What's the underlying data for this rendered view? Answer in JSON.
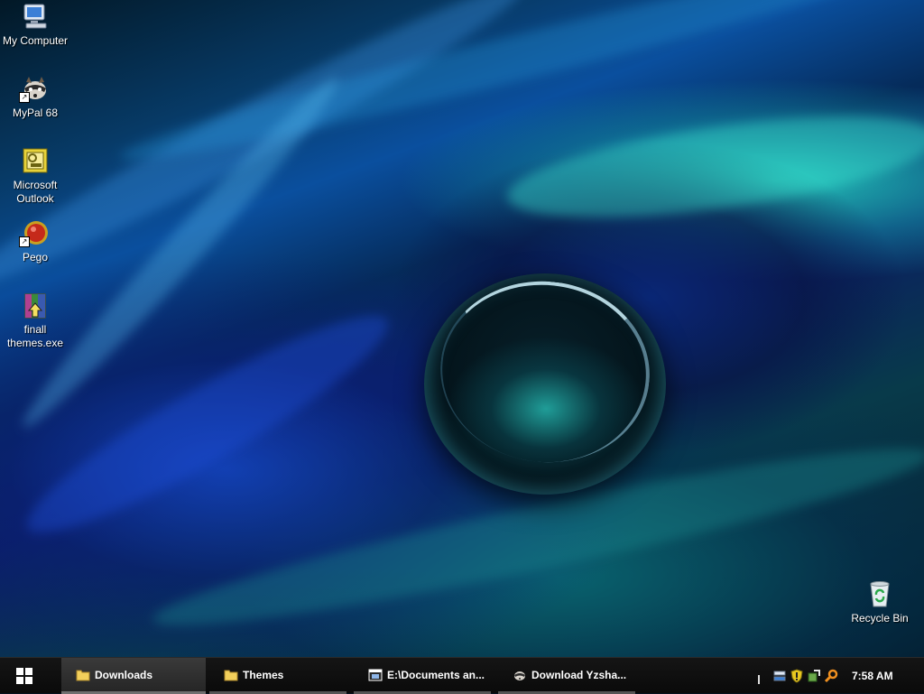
{
  "desktop": {
    "icons": [
      {
        "label": "My Computer",
        "icon": "my-computer-icon"
      },
      {
        "label": "MyPal 68",
        "icon": "mypal-icon"
      },
      {
        "label": "Microsoft Outlook",
        "icon": "outlook-icon"
      },
      {
        "label": "Pego",
        "icon": "pego-icon"
      },
      {
        "label": "finall themes.exe",
        "icon": "winrar-archive-icon"
      },
      {
        "label": "Recycle Bin",
        "icon": "recycle-bin-icon"
      }
    ]
  },
  "taskbar": {
    "start_icon": "windows-logo-icon",
    "tasks": [
      {
        "label": "Downloads",
        "icon": "folder-icon",
        "active": true
      },
      {
        "label": "Themes",
        "icon": "folder-icon",
        "active": false
      },
      {
        "label": "E:\\Documents an...",
        "icon": "explorer-window-icon",
        "active": false
      },
      {
        "label": "Download Yzsha...",
        "icon": "mypal-icon",
        "active": false
      }
    ],
    "tray_icons": [
      "network-icon",
      "security-shield-icon",
      "update-icon",
      "search-icon"
    ],
    "clock": "7:58 AM"
  },
  "colors": {
    "taskbar_bg": "#121212",
    "active_task_bg": "#333333",
    "text": "#ffffff"
  }
}
